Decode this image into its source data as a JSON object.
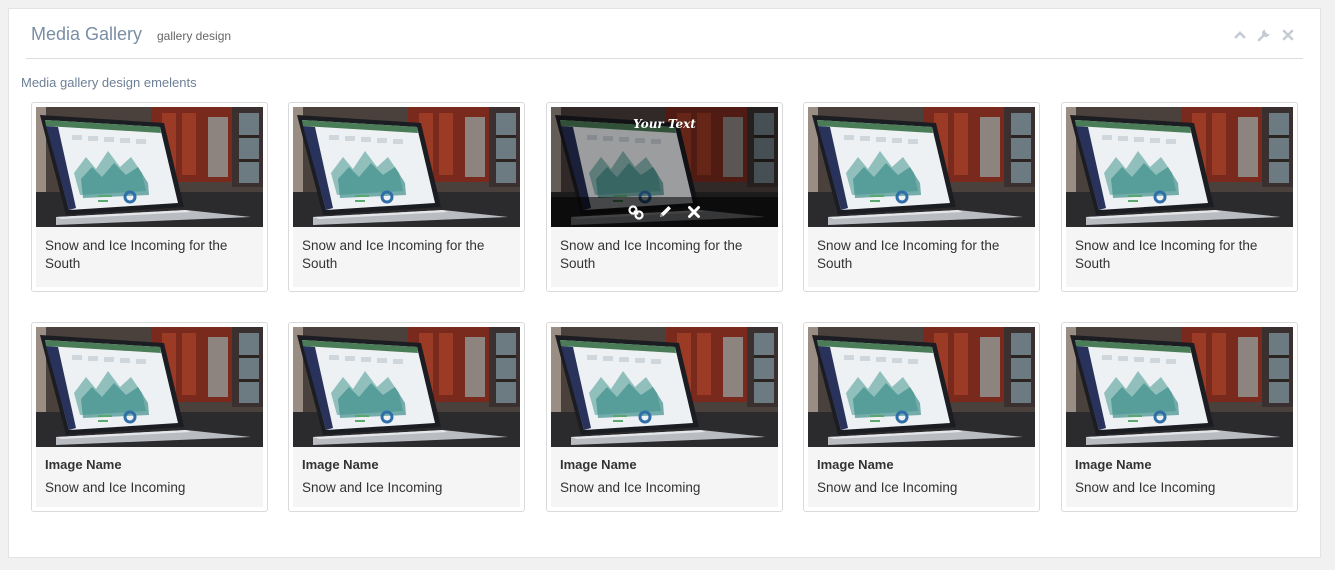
{
  "panel": {
    "title": "Media Gallery",
    "subtitle": "gallery design",
    "tools": [
      "chevron-up-icon",
      "wrench-icon",
      "close-icon"
    ]
  },
  "section_label": "Media gallery design emelents",
  "row1": [
    {
      "caption": "Snow and Ice Incoming for the South"
    },
    {
      "caption": "Snow and Ice Incoming for the South"
    },
    {
      "caption": "Snow and Ice Incoming for the South",
      "overlay_text": "Your Text",
      "overlay_icons": [
        "link-icon",
        "pencil-icon",
        "close-icon"
      ]
    },
    {
      "caption": "Snow and Ice Incoming for the South"
    },
    {
      "caption": "Snow and Ice Incoming for the South"
    }
  ],
  "row2": [
    {
      "name": "Image Name",
      "caption": "Snow and Ice Incoming"
    },
    {
      "name": "Image Name",
      "caption": "Snow and Ice Incoming"
    },
    {
      "name": "Image Name",
      "caption": "Snow and Ice Incoming"
    },
    {
      "name": "Image Name",
      "caption": "Snow and Ice Incoming"
    },
    {
      "name": "Image Name",
      "caption": "Snow and Ice Incoming"
    }
  ],
  "colors": {
    "title": "#7b8ea6",
    "panel_bg": "#ffffff",
    "page_bg": "#f1f1f1",
    "card_footer": "#f5f5f5"
  }
}
